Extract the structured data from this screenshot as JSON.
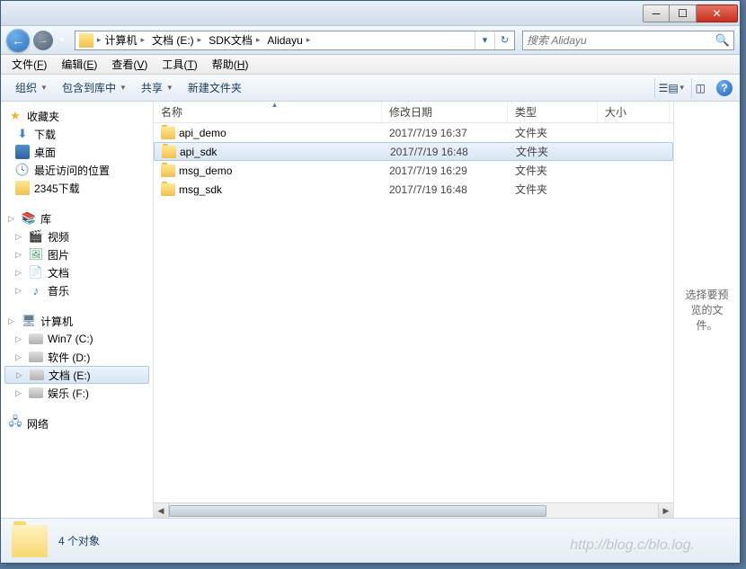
{
  "breadcrumb": [
    {
      "label": "计算机"
    },
    {
      "label": "文档 (E:)"
    },
    {
      "label": "SDK文档"
    },
    {
      "label": "Alidayu"
    }
  ],
  "search": {
    "placeholder": "搜索 Alidayu"
  },
  "menubar": [
    {
      "label": "文件",
      "key": "F"
    },
    {
      "label": "编辑",
      "key": "E"
    },
    {
      "label": "查看",
      "key": "V"
    },
    {
      "label": "工具",
      "key": "T"
    },
    {
      "label": "帮助",
      "key": "H"
    }
  ],
  "toolbar": {
    "organize": "组织",
    "include": "包含到库中",
    "share": "共享",
    "newfolder": "新建文件夹"
  },
  "sidebar": {
    "favorites": {
      "label": "收藏夹",
      "items": [
        {
          "label": "下载",
          "icon": "download"
        },
        {
          "label": "桌面",
          "icon": "desktop"
        },
        {
          "label": "最近访问的位置",
          "icon": "recent"
        },
        {
          "label": "2345下载",
          "icon": "folder"
        }
      ]
    },
    "libraries": {
      "label": "库",
      "items": [
        {
          "label": "视频",
          "icon": "video"
        },
        {
          "label": "图片",
          "icon": "picture"
        },
        {
          "label": "文档",
          "icon": "document"
        },
        {
          "label": "音乐",
          "icon": "music"
        }
      ]
    },
    "computer": {
      "label": "计算机",
      "items": [
        {
          "label": "Win7 (C:)",
          "icon": "drive-sys"
        },
        {
          "label": "软件 (D:)",
          "icon": "drive"
        },
        {
          "label": "文档 (E:)",
          "icon": "drive",
          "selected": true
        },
        {
          "label": "娱乐 (F:)",
          "icon": "drive"
        }
      ]
    },
    "network": {
      "label": "网络"
    }
  },
  "columns": {
    "name": "名称",
    "date": "修改日期",
    "type": "类型",
    "size": "大小"
  },
  "files": [
    {
      "name": "api_demo",
      "date": "2017/7/19 16:37",
      "type": "文件夹",
      "selected": false
    },
    {
      "name": "api_sdk",
      "date": "2017/7/19 16:48",
      "type": "文件夹",
      "selected": true
    },
    {
      "name": "msg_demo",
      "date": "2017/7/19 16:29",
      "type": "文件夹",
      "selected": false
    },
    {
      "name": "msg_sdk",
      "date": "2017/7/19 16:48",
      "type": "文件夹",
      "selected": false
    }
  ],
  "preview": {
    "empty": "选择要预览的文件。"
  },
  "status": {
    "count": "4 个对象"
  },
  "watermark": "http://blog.c/blo.log."
}
